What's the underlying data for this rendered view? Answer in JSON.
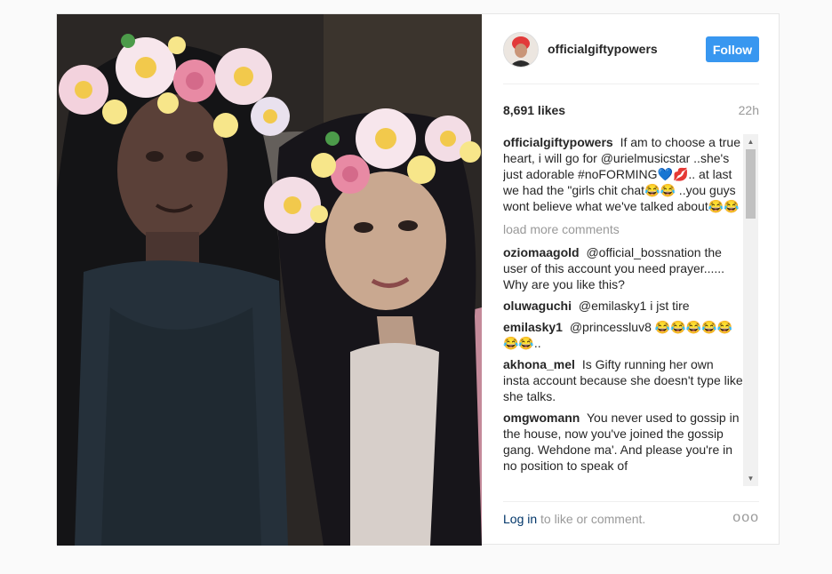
{
  "post": {
    "username": "officialgiftypowers",
    "follow_label": "Follow",
    "likes": "8,691 likes",
    "time": "22h",
    "caption": {
      "user": "officialgiftypowers",
      "text": "If am to choose a true heart, i will go for @urielmusicstar ..she's just adorable #noFORMING💙💋.. at last we had the \"girls chit chat😂😂 ..you guys wont believe what we've talked about😂😂"
    },
    "load_more": "load more comments",
    "comments": [
      {
        "user": "oziomaagold",
        "text": "@official_bossnation the user of this account you need prayer...... Why are you like this?"
      },
      {
        "user": "oluwaguchi",
        "text": "@emilasky1 i jst tire"
      },
      {
        "user": "emilasky1",
        "text": "@princessluv8 😂😂😂😂😂😂😂.."
      },
      {
        "user": "akhona_mel",
        "text": "Is Gifty running her own insta account because she doesn't type like she talks."
      },
      {
        "user": "omgwomann",
        "text": "You never used to gossip in the house, now you've joined the gossip gang. Wehdone ma'. And please you're in no position to speak of"
      }
    ],
    "footer": {
      "login_link": "Log in",
      "login_rest": " to like or comment.",
      "more_options": "ooo"
    },
    "icons": {
      "more": "more-options-icon",
      "scroll_up": "scroll-up-arrow-icon",
      "scroll_down": "scroll-down-arrow-icon"
    },
    "colors": {
      "follow_button": "#3897f0",
      "link": "#003569",
      "muted": "#999999"
    }
  }
}
